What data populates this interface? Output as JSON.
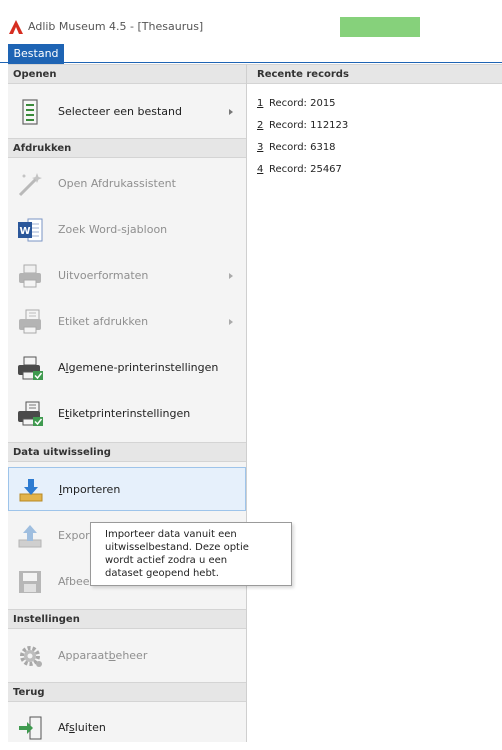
{
  "window": {
    "title": "Adlib Museum 4.5 - [Thesaurus]",
    "accent_color": "#86d17b",
    "app_icon": "adlib-logo-icon"
  },
  "menu": {
    "active_tab": "Bestand",
    "active_color": "#1e64b4"
  },
  "sections": {
    "openen": "Openen",
    "afdrukken": "Afdrukken",
    "data": "Data uitwisseling",
    "instellingen": "Instellingen",
    "terug": "Terug"
  },
  "items": {
    "selecteer": {
      "pre": "Selecteer een bestand",
      "acc": "",
      "post": "",
      "icon": "document-list-icon",
      "disabled": false
    },
    "afdrukassistent": {
      "pre": "Open Afdrukassistent",
      "acc": "",
      "post": "",
      "icon": "magic-wand-icon",
      "disabled": true
    },
    "word": {
      "pre": "Zoek Word-sjabloon",
      "acc": "",
      "post": "",
      "icon": "word-document-icon",
      "disabled": true
    },
    "uitvoer": {
      "pre": "Uitvoerformaten",
      "acc": "",
      "post": "",
      "icon": "printer-icon",
      "disabled": true
    },
    "etiket": {
      "pre": "Etiket afdrukken",
      "acc": "",
      "post": "",
      "icon": "label-printer-icon",
      "disabled": true
    },
    "algprinter": {
      "pre": "A",
      "acc": "l",
      "post": "gemene-printerinstellingen",
      "icon": "printer-settings-icon",
      "disabled": false
    },
    "etiketprinter": {
      "pre": "E",
      "acc": "t",
      "post": "iketprinterinstellingen",
      "icon": "label-printer-settings-icon",
      "disabled": false
    },
    "importeren": {
      "pre": "",
      "acc": "I",
      "post": "mporteren",
      "icon": "import-icon",
      "disabled": false
    },
    "exporteren": {
      "pre": "Expor",
      "acc": "",
      "post": "",
      "icon": "export-icon",
      "disabled": true
    },
    "afbeelding": {
      "pre": "Afbee",
      "acc": "",
      "post": "",
      "icon": "save-icon",
      "disabled": true
    },
    "apparaat": {
      "pre": "Apparaat",
      "acc": "b",
      "post": "eheer",
      "icon": "device-gear-icon",
      "disabled": true
    },
    "afsluiten": {
      "pre": "Af",
      "acc": "s",
      "post": "luiten",
      "icon": "exit-door-icon",
      "disabled": false
    }
  },
  "recent": {
    "header": "Recente records",
    "records": [
      {
        "num": "1",
        "label": "Record: 2015"
      },
      {
        "num": "2",
        "label": "Record: 112123"
      },
      {
        "num": "3",
        "label": "Record: 6318"
      },
      {
        "num": "4",
        "label": "Record: 25467"
      }
    ]
  },
  "tooltip": {
    "lines": [
      "Importeer data vanuit een",
      "uitwisselbestand. Deze optie",
      "wordt actief zodra u een",
      "dataset geopend hebt."
    ]
  }
}
